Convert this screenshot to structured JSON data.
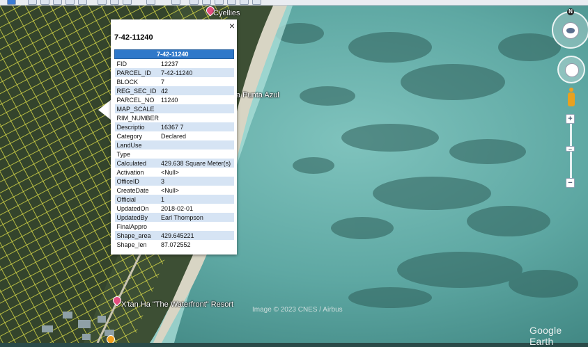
{
  "map": {
    "labels": {
      "top_place": "Cyellies",
      "beach": "a Punta Azul",
      "resort": "X'tan Ha \"The Waterfront\" Resort"
    },
    "copyright": "Image © 2023 CNES / Airbus",
    "brand": "Google Earth"
  },
  "nav": {
    "north_letter": "N",
    "zoom_in": "+",
    "zoom_out": "−"
  },
  "popup": {
    "title": "7-42-11240",
    "close_glyph": "×",
    "table_header": "7-42-11240",
    "rows": [
      {
        "field": "FID",
        "value": "12237"
      },
      {
        "field": "PARCEL_ID",
        "value": "7-42-11240"
      },
      {
        "field": "BLOCK",
        "value": "7"
      },
      {
        "field": "REG_SEC_ID",
        "value": "42"
      },
      {
        "field": "PARCEL_NO",
        "value": "11240"
      },
      {
        "field": "MAP_SCALE",
        "value": ""
      },
      {
        "field": "RIM_NUMBER",
        "value": ""
      },
      {
        "field": "Descriptio",
        "value": "16367 7"
      },
      {
        "field": "Category",
        "value": "Declared"
      },
      {
        "field": "LandUse",
        "value": ""
      },
      {
        "field": "Type",
        "value": ""
      },
      {
        "field": "Calculated",
        "value": "429.638 Square Meter(s)"
      },
      {
        "field": "Activation",
        "value": "<Null>"
      },
      {
        "field": "OfficeID",
        "value": "3"
      },
      {
        "field": "CreateDate",
        "value": "<Null>"
      },
      {
        "field": "Official",
        "value": "1"
      },
      {
        "field": "UpdatedOn",
        "value": "2018-02-01"
      },
      {
        "field": "UpdatedBy",
        "value": "Earl Thompson"
      },
      {
        "field": "FinalAppro",
        "value": ""
      },
      {
        "field": "Shape_area",
        "value": "429.645221"
      },
      {
        "field": "Shape_len",
        "value": "87.072552"
      }
    ]
  },
  "colors": {
    "header": "#2f78c9",
    "row_alt": "#d6e4f4",
    "pin": "#e24d7e",
    "parcel_lines": "#e8e84a"
  }
}
